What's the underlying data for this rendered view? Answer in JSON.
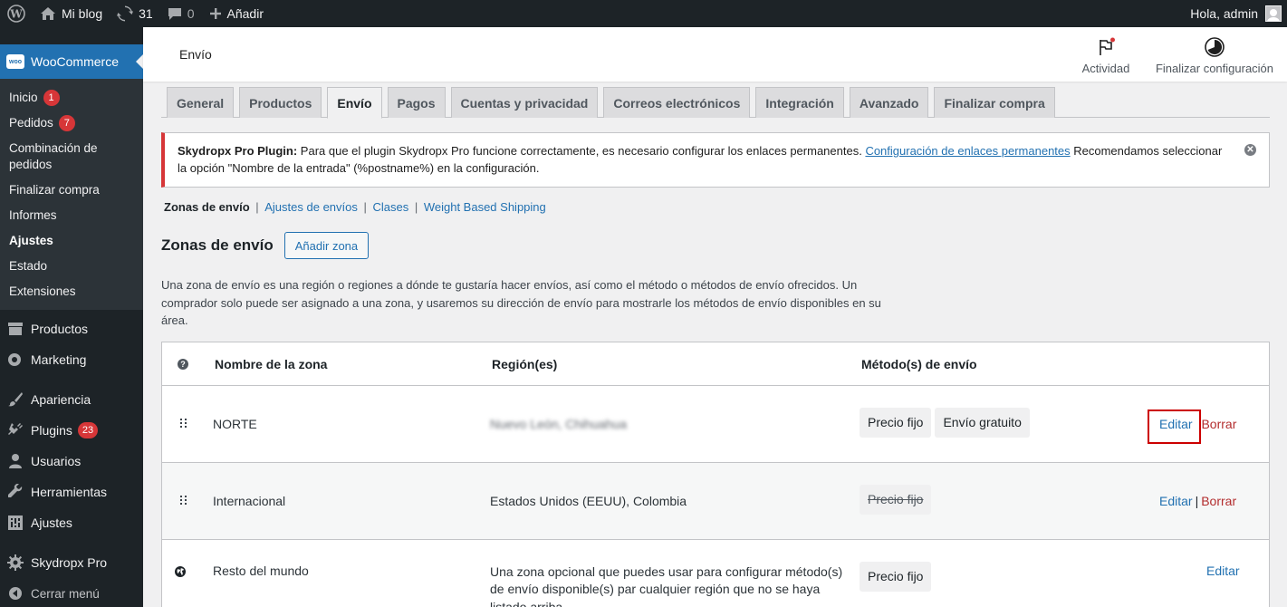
{
  "admin_bar": {
    "site_name": "Mi blog",
    "updates_count": "31",
    "comments_count": "0",
    "add_new": "Añadir",
    "greeting": "Hola, admin"
  },
  "sidebar": {
    "woocommerce": "WooCommerce",
    "sub_items": [
      {
        "label": "Inicio",
        "badge": "1"
      },
      {
        "label": "Pedidos",
        "badge": "7"
      },
      {
        "label": "Combinación de pedidos",
        "badge": null
      },
      {
        "label": "Finalizar compra",
        "badge": null
      },
      {
        "label": "Informes",
        "badge": null
      },
      {
        "label": "Ajustes",
        "badge": null,
        "current": true
      },
      {
        "label": "Estado",
        "badge": null
      },
      {
        "label": "Extensiones",
        "badge": null
      }
    ],
    "menu": {
      "productos": "Productos",
      "marketing": "Marketing",
      "apariencia": "Apariencia",
      "plugins": "Plugins",
      "plugins_badge": "23",
      "usuarios": "Usuarios",
      "herramientas": "Herramientas",
      "ajustes": "Ajustes",
      "skydropx": "Skydropx Pro",
      "collapse": "Cerrar menú"
    }
  },
  "header": {
    "title": "Envío",
    "activity": "Actividad",
    "finish_setup": "Finalizar configuración"
  },
  "tabs": [
    "General",
    "Productos",
    "Envío",
    "Pagos",
    "Cuentas y privacidad",
    "Correos electrónicos",
    "Integración",
    "Avanzado",
    "Finalizar compra"
  ],
  "active_tab": "Envío",
  "notice": {
    "plugin_name": "Skydropx Pro Plugin:",
    "text_before_link": " Para que el plugin Skydropx Pro funcione correctamente, es necesario configurar los enlaces permanentes. ",
    "link_text": "Configuración de enlaces permanentes",
    "text_after_link": " Recomendamos seleccionar la opción \"Nombre de la entrada\" (%postname%) en la configuración."
  },
  "subsub": {
    "current": "Zonas de envío",
    "links": [
      "Ajustes de envíos",
      "Clases",
      "Weight Based Shipping"
    ]
  },
  "zones": {
    "heading": "Zonas de envío",
    "add_button": "Añadir zona",
    "description": "Una zona de envío es una región o regiones a dónde te gustaría hacer envíos, así como el método o métodos de envío ofrecidos. Un comprador solo puede ser asignado a una zona, y usaremos su dirección de envío para mostrarle los métodos de envío disponibles en su área.",
    "columns": {
      "name": "Nombre de la zona",
      "regions": "Región(es)",
      "methods": "Método(s) de envío"
    },
    "rows": [
      {
        "name": "NORTE",
        "regions": "Nuevo León, Chihuahua",
        "methods": [
          "Precio fijo",
          "Envío gratuito"
        ],
        "edit": "Editar",
        "delete": "Borrar"
      },
      {
        "name": "Internacional",
        "regions": "Estados Unidos (EEUU), Colombia",
        "methods": [
          "Precio fijo"
        ],
        "edit": "Editar",
        "delete": "Borrar"
      },
      {
        "name": "Resto del mundo",
        "regions": "Una zona opcional que puedes usar para configurar método(s) de envío disponible(s) par cualquier región que no se haya listado arriba.",
        "methods": [
          "Precio fijo"
        ],
        "edit": "Editar"
      }
    ]
  }
}
